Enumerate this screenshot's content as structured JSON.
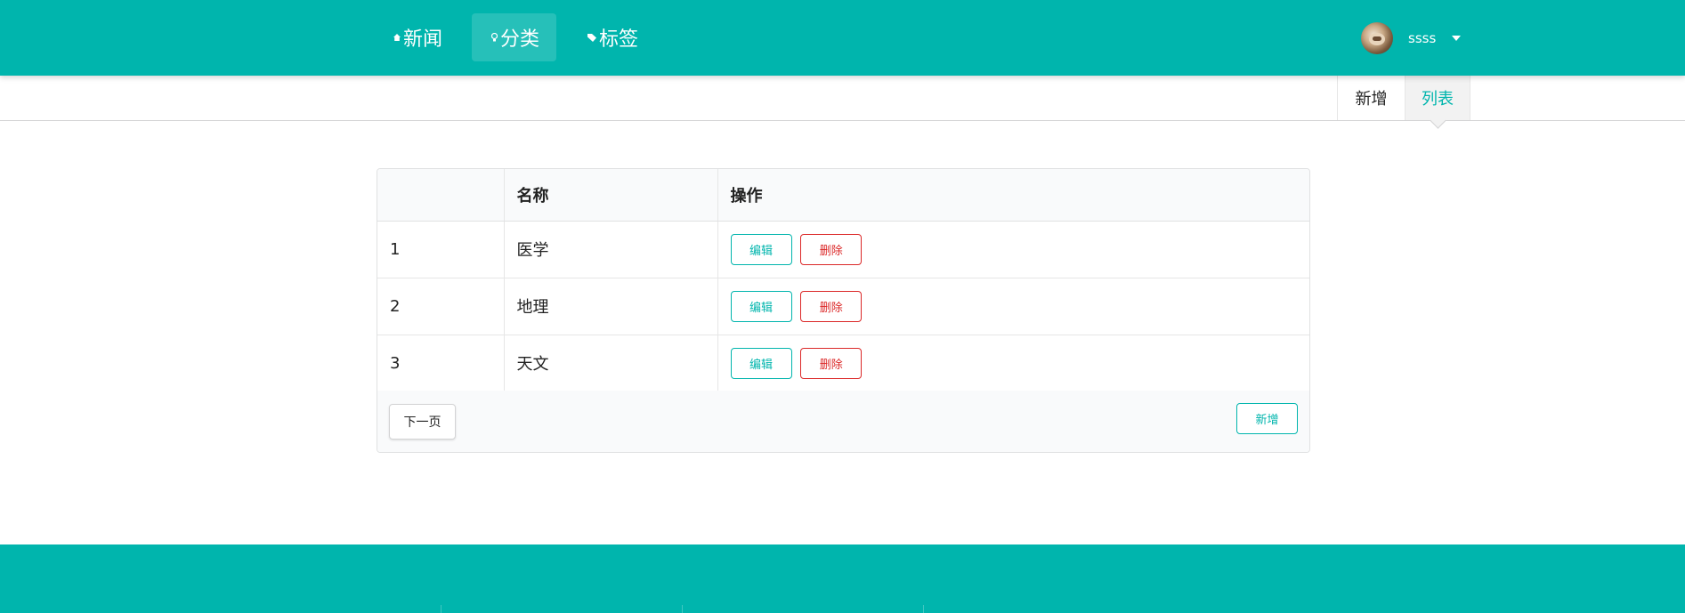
{
  "nav": {
    "items": [
      {
        "label": "新闻",
        "icon": "home-icon"
      },
      {
        "label": "分类",
        "icon": "idea-icon"
      },
      {
        "label": "标签",
        "icon": "tag-icon"
      }
    ],
    "active": "分类",
    "user": {
      "name": "ssss",
      "avatar": "avatar-image"
    }
  },
  "subnav": {
    "tabs": [
      {
        "label": "新增"
      },
      {
        "label": "列表"
      }
    ],
    "active": "列表"
  },
  "table": {
    "headers": [
      "",
      "名称",
      "操作"
    ],
    "rows": [
      {
        "id": "1",
        "name": "医学"
      },
      {
        "id": "2",
        "name": "地理"
      },
      {
        "id": "3",
        "name": "天文"
      }
    ],
    "edit_label": "编辑",
    "delete_label": "删除",
    "next_label": "下一页",
    "new_label": "新增"
  },
  "colors": {
    "brand": "#00b5ad",
    "danger": "#db2828",
    "header_bg": "#f9fafb"
  }
}
